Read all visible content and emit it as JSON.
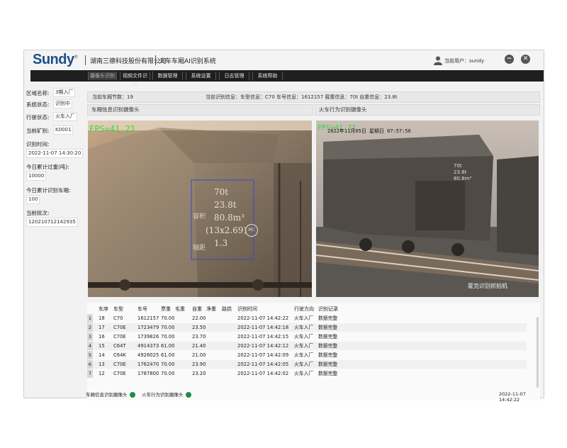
{
  "header": {
    "logo": "Sundy",
    "logo_mark": "®",
    "company": "湖南三德科技股份有限公司",
    "system_name": "火车车厢AI识别系统",
    "user_label": "当前用户：sundy",
    "minimize_glyph": "−",
    "close_glyph": "✕"
  },
  "nav": {
    "tabs": [
      {
        "label": "摄像头识别",
        "active": true
      },
      {
        "label": "视频文件识别",
        "active": false
      },
      {
        "label": "数据管理",
        "active": false
      },
      {
        "label": "系统设置",
        "active": false
      },
      {
        "label": "日志管理",
        "active": false
      },
      {
        "label": "系统帮助",
        "active": false
      }
    ]
  },
  "left_panel": {
    "area_label": "区域名称:",
    "area_value": "3期入厂",
    "system_status_label": "系统状态:",
    "system_status_value": "识别中",
    "driving_status_label": "行驶状态:",
    "driving_status_value": "火车入厂",
    "current_mine_label": "当前矿别:",
    "current_mine_value": "K0001",
    "recognize_time_label": "识别时间:",
    "recognize_time_value": "2022-11-07 14:30:20",
    "today_weight_label": "今日累计过重(吨):",
    "today_weight_value": "10000",
    "today_count_label": "今日累计识别车厢:",
    "today_count_value": "100",
    "current_batch_label": "当前批次:",
    "current_batch_value": "120210712142935"
  },
  "info_bar": {
    "carriage_count": "当前车厢节数：19",
    "current_info": "当前识别信息：车型信息：C70  车号信息：1612157  载重信息：70t  自重信息：23.8t"
  },
  "cameras": {
    "left_title": "车厢信息识别摄像头",
    "right_title": "火车行为识别摄像头",
    "left_fps": "FPS=41.21",
    "right_fps": "FPS=41.21",
    "right_timestamp": "2022年11月05日 星期日 07:57:56",
    "right_caption": "霍克识别抓拍机",
    "plate_lines": [
      "70t",
      "23.8t",
      "80.8m³",
      "(13x2.69)",
      "1.3"
    ],
    "plate_left_labels": [
      "容积",
      "轴距"
    ],
    "plate_badge": "MC"
  },
  "table": {
    "headers": [
      "车序",
      "车型",
      "车号",
      "票重",
      "毛重",
      "自重",
      "净重",
      "路损",
      "识别时间",
      "行驶方向",
      "识别记录"
    ],
    "rows": [
      {
        "idx": "1",
        "seq": "18",
        "type": "C70",
        "number": "1612157",
        "ticket": "70.00",
        "gross": "",
        "tare": "22.00",
        "net": "",
        "loss": "",
        "time": "2022-11-07 14:42:22",
        "dir": "火车入厂",
        "record": "数据完整"
      },
      {
        "idx": "2",
        "seq": "17",
        "type": "C70E",
        "number": "1723479",
        "ticket": "70.00",
        "gross": "",
        "tare": "23.50",
        "net": "",
        "loss": "",
        "time": "2022-11-07 14:42:18",
        "dir": "火车入厂",
        "record": "数据完整"
      },
      {
        "idx": "3",
        "seq": "16",
        "type": "C70E",
        "number": "1739826",
        "ticket": "70.00",
        "gross": "",
        "tare": "23.70",
        "net": "",
        "loss": "",
        "time": "2022-11-07 14:42:15",
        "dir": "火车入厂",
        "record": "数据完整"
      },
      {
        "idx": "4",
        "seq": "15",
        "type": "C64T",
        "number": "4914373",
        "ticket": "61.00",
        "gross": "",
        "tare": "21.40",
        "net": "",
        "loss": "",
        "time": "2022-11-07 14:42:12",
        "dir": "火车入厂",
        "record": "数据完整"
      },
      {
        "idx": "5",
        "seq": "14",
        "type": "C64K",
        "number": "4926025",
        "ticket": "61.00",
        "gross": "",
        "tare": "21.00",
        "net": "",
        "loss": "",
        "time": "2022-11-07 14:42:09",
        "dir": "火车入厂",
        "record": "数据完整"
      },
      {
        "idx": "6",
        "seq": "13",
        "type": "C70E",
        "number": "1762470",
        "ticket": "70.00",
        "gross": "",
        "tare": "23.90",
        "net": "",
        "loss": "",
        "time": "2022-11-07 14:42:05",
        "dir": "火车入厂",
        "record": "数据完整"
      },
      {
        "idx": "7",
        "seq": "12",
        "type": "C70E",
        "number": "1787800",
        "ticket": "70.00",
        "gross": "",
        "tare": "23.20",
        "net": "",
        "loss": "",
        "time": "2022-11-07 14:42:02",
        "dir": "火车入厂",
        "record": "数据完整"
      }
    ]
  },
  "status_bar": {
    "cam1_label": "车厢信息识别摄像头",
    "cam2_label": "火车行为识别摄像头",
    "datetime": "2022-11-07 14:42:22",
    "ok_color": "#1d8f3e"
  }
}
